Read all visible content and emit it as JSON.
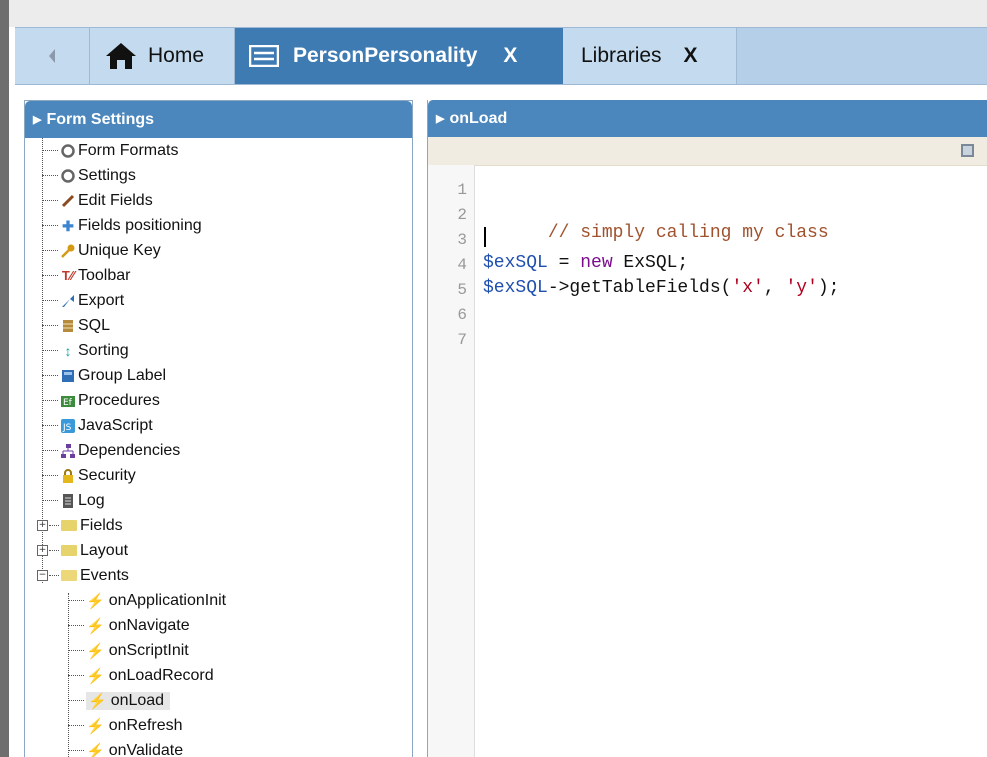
{
  "tabs": [
    {
      "id": "home",
      "label": "Home",
      "closable": false
    },
    {
      "id": "personpersonality",
      "label": "PersonPersonality",
      "close": "X",
      "active": true
    },
    {
      "id": "libraries",
      "label": "Libraries",
      "close": "X"
    }
  ],
  "left_panel": {
    "title": "Form Settings",
    "items": [
      {
        "label": "Form Formats",
        "icon": "gear-icon"
      },
      {
        "label": "Settings",
        "icon": "gear-icon"
      },
      {
        "label": "Edit Fields",
        "icon": "pencil-icon"
      },
      {
        "label": "Fields positioning",
        "icon": "move-arrows-icon"
      },
      {
        "label": "Unique Key",
        "icon": "key-icon"
      },
      {
        "label": "Toolbar",
        "icon": "toolbar-icon"
      },
      {
        "label": "Export",
        "icon": "export-icon"
      },
      {
        "label": "SQL",
        "icon": "database-icon"
      },
      {
        "label": "Sorting",
        "icon": "sort-arrows-icon"
      },
      {
        "label": "Group Label",
        "icon": "group-label-icon"
      },
      {
        "label": "Procedures",
        "icon": "procedures-icon"
      },
      {
        "label": "JavaScript",
        "icon": "javascript-icon"
      },
      {
        "label": "Dependencies",
        "icon": "hierarchy-icon"
      },
      {
        "label": "Security",
        "icon": "lock-icon"
      },
      {
        "label": "Log",
        "icon": "log-icon"
      }
    ],
    "folders": [
      {
        "label": "Fields",
        "expander": "+"
      },
      {
        "label": "Layout",
        "expander": "+"
      },
      {
        "label": "Events",
        "expander": "−"
      }
    ],
    "events": [
      {
        "label": "onApplicationInit",
        "active": true
      },
      {
        "label": "onNavigate",
        "active": false
      },
      {
        "label": "onScriptInit",
        "active": true
      },
      {
        "label": "onLoadRecord",
        "active": false
      },
      {
        "label": "onLoad",
        "active": true,
        "selected": true
      },
      {
        "label": "onRefresh",
        "active": false
      },
      {
        "label": "onValidate",
        "active": false
      }
    ]
  },
  "editor": {
    "title": "onLoad",
    "line_numbers": [
      "1",
      "2",
      "3",
      "4",
      "5",
      "6",
      "7"
    ],
    "code": {
      "line2_comment": "// simply calling my class",
      "line4_var": "$exSQL",
      "line4_op": " = ",
      "line4_kw": "new",
      "line4_rest": " ExSQL;",
      "line5_var": "$exSQL",
      "line5_call": "->getTableFields(",
      "line5_str1": "'x'",
      "line5_sep": ", ",
      "line5_str2": "'y'",
      "line5_end": ");"
    }
  },
  "colors": {
    "panel_header": "#4b87bd",
    "active_tab": "#3e7bb3",
    "tab_bar": "#b5cfe8",
    "comment": "#a0522d",
    "variable": "#1f4faf",
    "keyword": "#7c0e8e",
    "string": "#b00020"
  }
}
